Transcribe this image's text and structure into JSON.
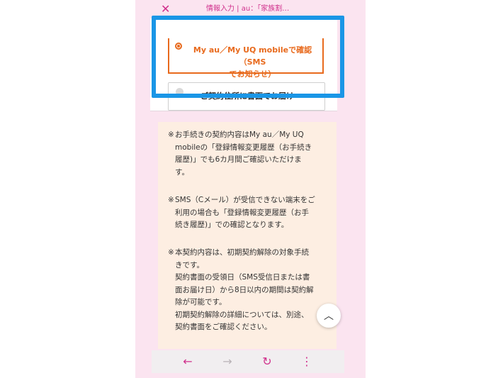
{
  "topbar": {
    "close_icon": "close-icon",
    "title": "情報入力 | au：「家族割…"
  },
  "options": {
    "sms_label": "My au／My UQ mobileで確認（SMS\nでお知らせ）",
    "mail_label": "ご契約住所に書面でお届け"
  },
  "notices": [
    {
      "mark": "※",
      "text": "お手続きの契約内容はMy au／My UQ\nmobileの「登録情報変更履歴（お手続き\n履歴)」でも6カ月間ご確認いただけま\nす。"
    },
    {
      "mark": "※",
      "text": "SMS（Cメール）が受信できない端末をご\n利用の場合も「登録情報変更履歴（お手\n続き履歴)」での確認となります。"
    },
    {
      "mark": "※",
      "text": "本契約内容は、初期契約解除の対象手続\nきです。\n契約書面の受領日（SMS受信日または書\n面お届け日）から8日以内の期間は契約解\n除が可能です。\n初期契約解除の詳細については、別途、\n契約書面をご確認ください。"
    }
  ],
  "scroll_up_glyph": "︿",
  "nav": {
    "back": "←",
    "forward": "→",
    "reload": "↻",
    "menu": "⋮"
  },
  "colors": {
    "accent_pink": "#d0308c",
    "accent_orange": "#e86a1d",
    "highlight_blue": "#1a96e6"
  }
}
